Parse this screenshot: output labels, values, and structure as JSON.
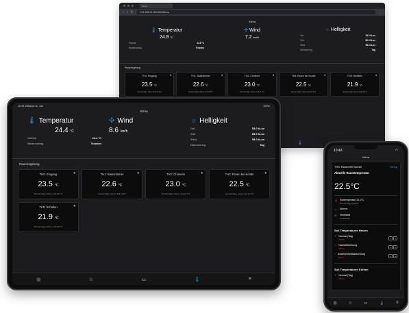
{
  "browser": {
    "tab_label": "Klima",
    "url": "192.168.10.100:8123/klima",
    "page_title": "Klima",
    "weather": {
      "temp": {
        "label": "Temperatur",
        "value": "24.8",
        "unit": "°C",
        "rows": [
          {
            "k": "Gefühlt",
            "v": "24.8 °C"
          },
          {
            "k": "Niederschlag",
            "v": "Trocken"
          }
        ]
      },
      "wind": {
        "label": "Wind",
        "value": "7.2",
        "unit": "km/h"
      },
      "light": {
        "label": "Helligkeit",
        "rows": [
          {
            "k": "Ost",
            "v": "33.0 kLux"
          },
          {
            "k": "Süd",
            "v": "80.0 kLux"
          },
          {
            "k": "West",
            "v": "95.0 kLux"
          },
          {
            "k": "Dämmerung",
            "v": "Tag"
          }
        ]
      }
    },
    "section_title": "Raumregelung",
    "cards": [
      {
        "name": "TH0: Eingang",
        "temp": "23.5",
        "unit": "°C",
        "sub": "Normal (Tag) | Heizen Soll 21.0°C"
      },
      {
        "name": "TH1: Badezimmer",
        "temp": "22.6",
        "unit": "°C",
        "sub": "Normal (Tag) | Heizen Soll 21.0°C"
      },
      {
        "name": "TH2: Chminée",
        "temp": "23.0",
        "unit": "°C",
        "sub": "Normal (Tag) | Heizen Soll 21.0°C"
      },
      {
        "name": "TH3: Essen bei Kombi",
        "temp": "22.5",
        "unit": "°C",
        "sub": "Normal (Tag) | Heizen Soll 21.0°C"
      },
      {
        "name": "TH5: Schlafen",
        "temp": "21.9",
        "unit": "°C",
        "sub": "Normal (Tag) | Heizen Soll 21.0°C"
      }
    ]
  },
  "tablet": {
    "status_left": "10:44  Mittwoch 6. Juli",
    "status_right": "100%",
    "page_title": "Klima",
    "weather": {
      "temp": {
        "label": "Temperatur",
        "value": "24.4",
        "unit": "°C",
        "rows": [
          {
            "k": "Gefühlt",
            "v": "24.4 °C"
          },
          {
            "k": "Niederschlag",
            "v": "Trocken"
          }
        ]
      },
      "wind": {
        "label": "Wind",
        "value": "8.6",
        "unit": "km/h"
      },
      "light": {
        "label": "Helligkeit",
        "rows": [
          {
            "k": "Ost",
            "v": "55.0 kLux"
          },
          {
            "k": "Süd",
            "v": "85.0 kLux"
          },
          {
            "k": "West",
            "v": "55.0 kLux"
          },
          {
            "k": "Dämmerung",
            "v": "Tag"
          }
        ]
      }
    },
    "section_title": "Raumregelung",
    "cards": [
      {
        "name": "TH0: Eingang",
        "temp": "23.5",
        "unit": "°C",
        "sub": "Normal (Tag) | Heizen Soll 21.0°C"
      },
      {
        "name": "TH1: Badezimmer",
        "temp": "22.6",
        "unit": "°C",
        "sub": "Normal (Tag) | Heizen Soll 21.0°C"
      },
      {
        "name": "TH2: Chminée",
        "temp": "23.0",
        "unit": "°C",
        "sub": "Normal (Tag) | Heizen Soll 21.0°C"
      },
      {
        "name": "TH3: Essen bei Kombi",
        "temp": "22.5",
        "unit": "°C",
        "sub": "Normal (Tag) | Heizen Soll 21.0°C"
      },
      {
        "name": "TH5: Schlafen",
        "temp": "21.9",
        "unit": "°C",
        "sub": "Normal (Tag) | Heizen Soll 21.0°C"
      }
    ],
    "tabbar": [
      "◎",
      "☆",
      "▭",
      "🌡",
      "≡"
    ]
  },
  "phone": {
    "time": "10:43",
    "page_title": "Klima",
    "card_title": "TH3: Essen bei Kombi",
    "card_link": "Verlag",
    "current_label": "Aktuelle Raumtemperatur",
    "current_value": "22.5°C",
    "items": [
      {
        "icon": "🌡",
        "label": "Solltemperatur 21.0°C",
        "sub": "Normal (Tag) | Heizen"
      },
      {
        "icon": "⚠",
        "label": "Alarme",
        "sub": ""
      },
      {
        "icon": "⚙",
        "label": "Ventilstell",
        "sub": "Großbetrieb"
      }
    ],
    "heat_title": "Soll Temperaturen Heizen",
    "heat_rows": [
      {
        "icon": "☀",
        "label": "Normal (Tag)",
        "sub": "21.0°C"
      },
      {
        "icon": "☾",
        "label": "Nachtabsenkung",
        "sub": "18.0°C"
      },
      {
        "icon": "⌂",
        "label": "Abwesenheitsabsenkung",
        "sub": "16.0°C"
      }
    ],
    "cool_title": "Soll Temperaturen Kühlen",
    "cool_rows": [
      {
        "icon": "☀",
        "label": "Normal (Tag)",
        "sub": "25.0°C"
      }
    ],
    "tabbar": [
      "◎",
      "☆",
      "▭",
      "🌡",
      "≡"
    ]
  }
}
